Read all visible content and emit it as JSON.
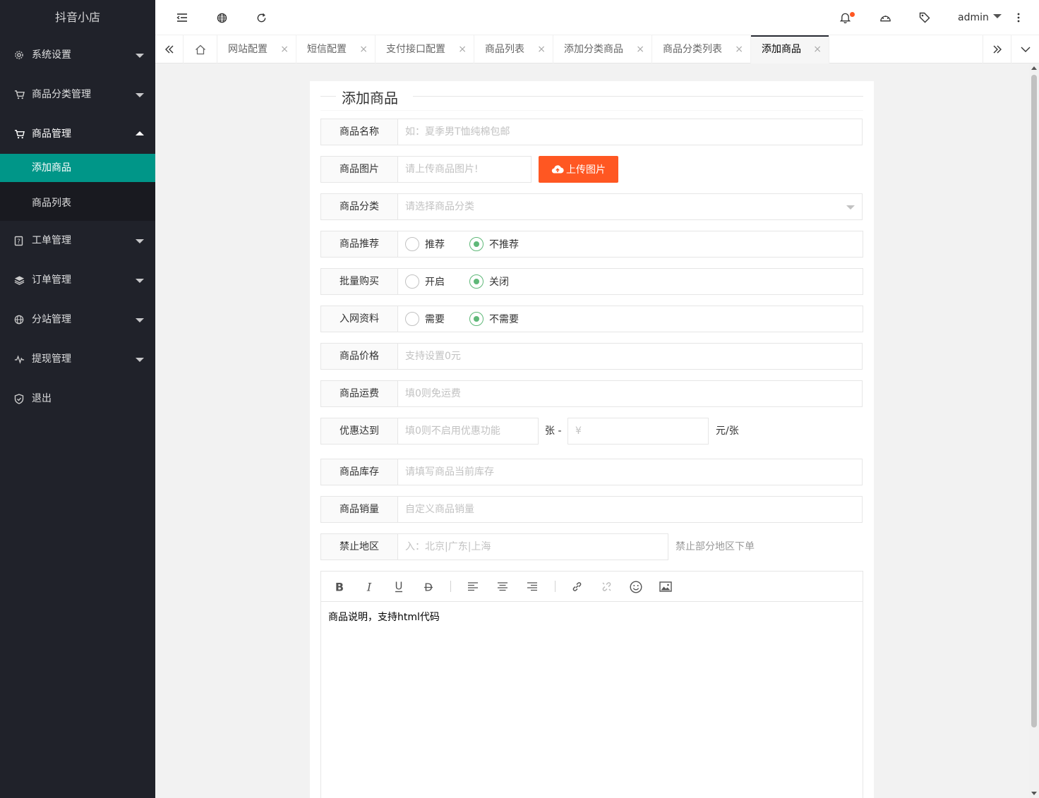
{
  "app": {
    "title": "抖音小店"
  },
  "sidebar": {
    "items": [
      {
        "label": "系统设置",
        "icon": "gear-icon"
      },
      {
        "label": "商品分类管理",
        "icon": "cart-icon"
      },
      {
        "label": "商品管理",
        "icon": "cart-icon",
        "open": true,
        "children": [
          {
            "label": "添加商品",
            "active": true
          },
          {
            "label": "商品列表"
          }
        ]
      },
      {
        "label": "工单管理",
        "icon": "ticket-icon"
      },
      {
        "label": "订单管理",
        "icon": "layers-icon"
      },
      {
        "label": "分站管理",
        "icon": "globe-icon"
      },
      {
        "label": "提现管理",
        "icon": "pulse-icon"
      },
      {
        "label": "退出",
        "icon": "shield-icon"
      }
    ]
  },
  "header": {
    "user": "admin",
    "notification_dot_color": "#ff5722"
  },
  "tabs": {
    "items": [
      {
        "label": "网站配置"
      },
      {
        "label": "短信配置"
      },
      {
        "label": "支付接口配置"
      },
      {
        "label": "商品列表"
      },
      {
        "label": "添加分类商品"
      },
      {
        "label": "商品分类列表"
      },
      {
        "label": "添加商品",
        "active": true
      }
    ],
    "close_glyph": "×"
  },
  "form": {
    "title": "添加商品",
    "name": {
      "label": "商品名称",
      "placeholder": "如：夏季男T恤纯棉包邮"
    },
    "image": {
      "label": "商品图片",
      "placeholder": "请上传商品图片!",
      "button": "上传图片"
    },
    "category": {
      "label": "商品分类",
      "placeholder": "请选择商品分类"
    },
    "recommend": {
      "label": "商品推荐",
      "options": [
        "推荐",
        "不推荐"
      ],
      "selected": "不推荐"
    },
    "bulk": {
      "label": "批量购买",
      "options": [
        "开启",
        "关闭"
      ],
      "selected": "关闭"
    },
    "network": {
      "label": "入网资料",
      "options": [
        "需要",
        "不需要"
      ],
      "selected": "不需要"
    },
    "price": {
      "label": "商品价格",
      "placeholder": "支持设置0元"
    },
    "shipping": {
      "label": "商品运费",
      "placeholder": "填0则免运费"
    },
    "discount": {
      "label": "优惠达到",
      "placeholder": "填0则不启用优惠功能",
      "unit1": "张 -",
      "price_placeholder": "¥",
      "unit2": "元/张"
    },
    "stock": {
      "label": "商品库存",
      "placeholder": "请填写商品当前库存"
    },
    "sales": {
      "label": "商品销量",
      "placeholder": "自定义商品销量"
    },
    "region": {
      "label": "禁止地区",
      "placeholder": "入：北京|广东|上海",
      "hint": "禁止部分地区下单"
    },
    "editor": {
      "content": "商品说明，支持html代码"
    }
  },
  "colors": {
    "sidebar_bg": "#20222a",
    "accent": "#009688",
    "upload_btn": "#ff5722",
    "radio_checked": "#5FB878"
  }
}
